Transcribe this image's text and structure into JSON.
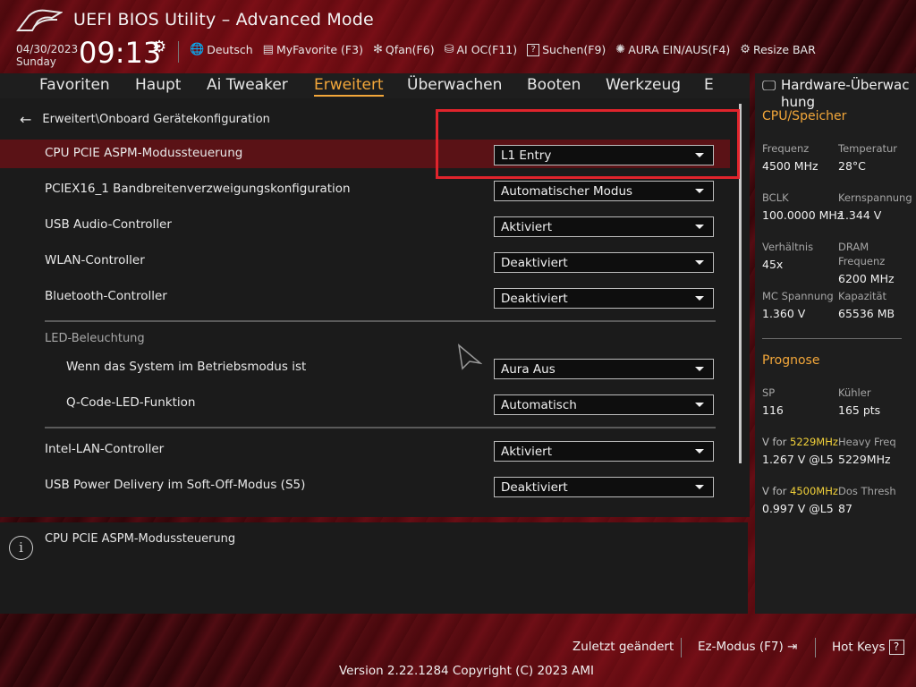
{
  "header": {
    "title": "UEFI BIOS Utility – Advanced Mode",
    "date": "04/30/2023",
    "day": "Sunday",
    "time": "09:13"
  },
  "toolbar": [
    {
      "icon": "globe-icon",
      "glyph": "🌐",
      "label": "Deutsch"
    },
    {
      "icon": "favorite-icon",
      "glyph": "▤",
      "label": "MyFavorite (F3)"
    },
    {
      "icon": "fan-icon",
      "glyph": "✻",
      "label": "Qfan(F6)"
    },
    {
      "icon": "ai-oc-icon",
      "glyph": "⛁",
      "label": "AI OC(F11)"
    },
    {
      "icon": "search-help-icon",
      "glyph": "?",
      "label": "Suchen(F9)"
    },
    {
      "icon": "aura-icon",
      "glyph": "✺",
      "label": "AURA EIN/AUS(F4)"
    },
    {
      "icon": "resize-bar-icon",
      "glyph": "⚙",
      "label": "Resize BAR"
    }
  ],
  "tabs": [
    "Favoriten",
    "Haupt",
    "Ai Tweaker",
    "Erweitert",
    "Überwachen",
    "Booten",
    "Werkzeug",
    "E"
  ],
  "active_tab": "Erweitert",
  "breadcrumb": "Erweitert\\Onboard Gerätekonfiguration",
  "settings": [
    {
      "label": "CPU PCIE ASPM-Modussteuerung",
      "value": "L1 Entry"
    },
    {
      "label": "PCIEX16_1 Bandbreitenverzweigungskonfiguration",
      "value": "Automatischer Modus"
    },
    {
      "label": "USB Audio-Controller",
      "value": "Aktiviert"
    },
    {
      "label": "WLAN-Controller",
      "value": "Deaktiviert"
    },
    {
      "label": "Bluetooth-Controller",
      "value": "Deaktiviert"
    },
    {
      "label": "Wenn das System im Betriebsmodus ist",
      "value": "Aura Aus"
    },
    {
      "label": "Q-Code-LED-Funktion",
      "value": "Automatisch"
    },
    {
      "label": "Intel-LAN-Controller",
      "value": "Aktiviert"
    },
    {
      "label": "USB Power Delivery im Soft-Off-Modus (S5)",
      "value": "Deaktiviert"
    }
  ],
  "section_led": "LED-Beleuchtung",
  "help_text": "CPU PCIE ASPM-Modussteuerung",
  "hw": {
    "title": "Hardware-Überwachung",
    "title_line1": "Hardware-Überwac",
    "title_line2": "hung",
    "cpu_section": "CPU/Speicher",
    "freq_label": "Frequenz",
    "freq_value": "4500 MHz",
    "temp_label": "Temperatur",
    "temp_value": "28°C",
    "bclk_label": "BCLK",
    "bclk_value": "100.0000 MHz",
    "vcore_label": "Kernspannung",
    "vcore_value": "1.344 V",
    "ratio_label": "Verhältnis",
    "ratio_value": "45x",
    "dram_label_1": "DRAM",
    "dram_label_2": "Frequenz",
    "dram_value": "6200 MHz",
    "mc_label": "MC Spannung",
    "mc_value": "1.360 V",
    "cap_label": "Kapazität",
    "cap_value": "65536 MB",
    "prognose_section": "Prognose",
    "sp_label": "SP",
    "sp_value": "116",
    "cooler_label": "Kühler",
    "cooler_value": "165 pts",
    "v1_prefix": "V for ",
    "v1_freq": "5229MHz",
    "v1_value": "1.267 V @L5",
    "heavy_label": "Heavy Freq",
    "heavy_value": "5229MHz",
    "v2_prefix": "V for ",
    "v2_freq": "4500MHz",
    "v2_value": "0.997 V @L5",
    "dos_label": "Dos Thresh",
    "dos_value": "87"
  },
  "footer": {
    "last_changed": "Zuletzt geändert",
    "ez_mode": "Ez-Modus (F7)",
    "hot_keys": "Hot Keys",
    "hot_keys_box": "?",
    "version": "Version 2.22.1284 Copyright (C) 2023 AMI"
  },
  "colors": {
    "accent": "#f3a73a",
    "highlight_row": "#5a1216",
    "annotation_box": "#e0242c",
    "yellow_value": "#f3d23a"
  }
}
